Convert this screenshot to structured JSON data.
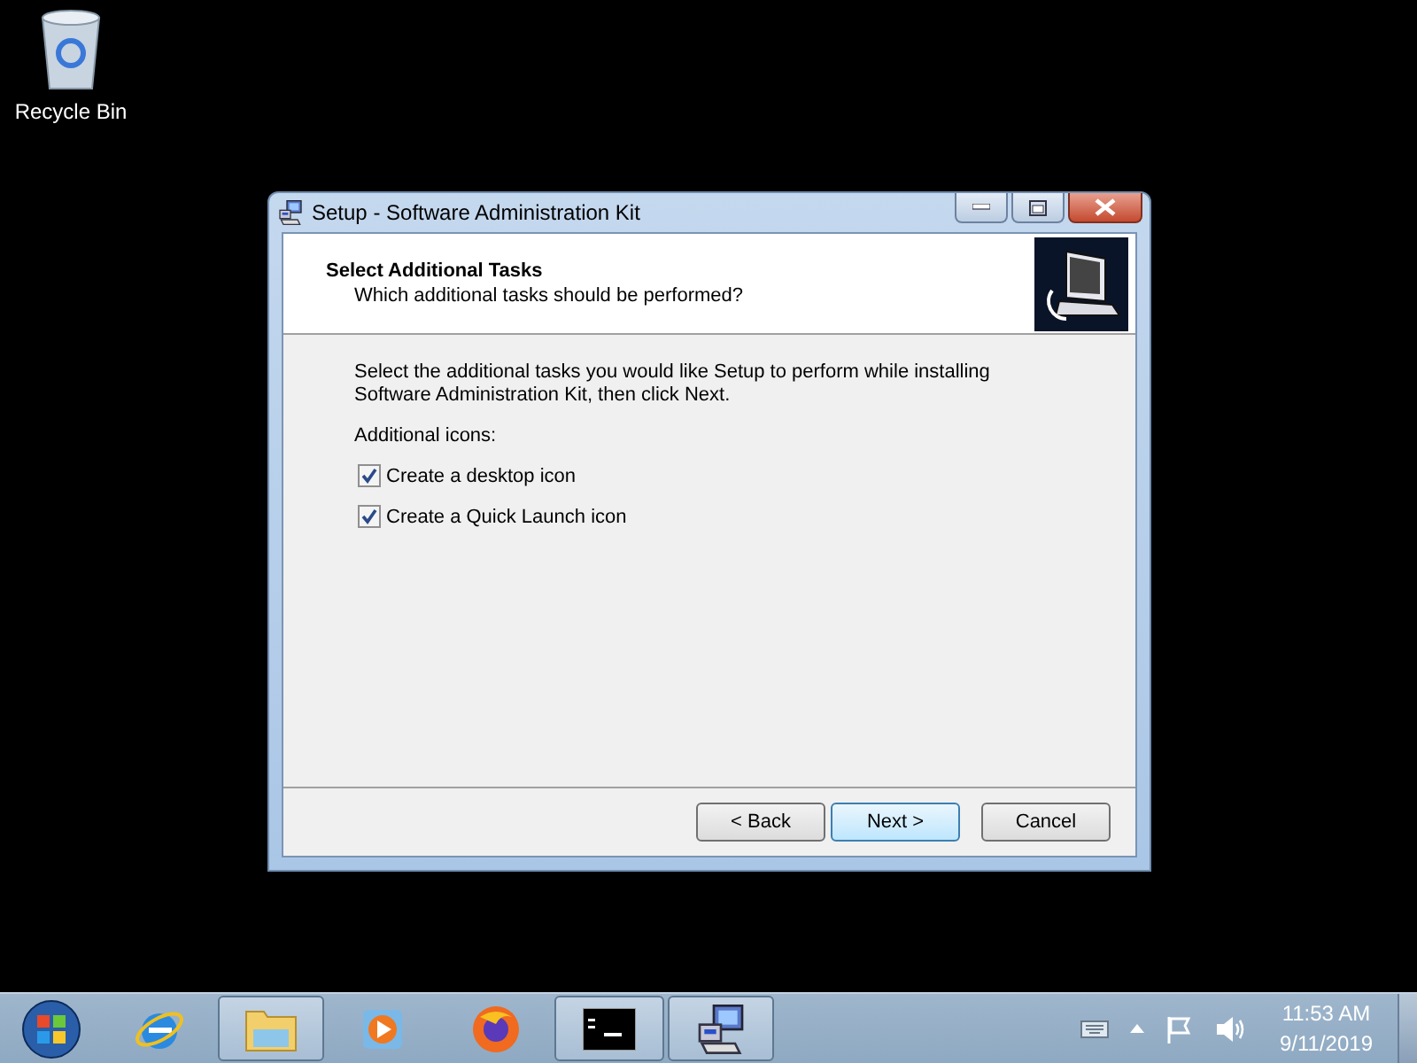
{
  "desktop": {
    "icons": [
      {
        "label": "Recycle Bin"
      }
    ]
  },
  "dialog": {
    "title": "Setup - Software Administration Kit",
    "header": {
      "title": "Select Additional Tasks",
      "subtitle": "Which additional tasks should be performed?"
    },
    "intro": "Select the additional tasks you would like Setup to perform while installing Software Administration Kit, then click Next.",
    "group_label": "Additional icons:",
    "tasks": [
      {
        "label": "Create a desktop icon",
        "checked": true
      },
      {
        "label": "Create a Quick Launch icon",
        "checked": true
      }
    ],
    "buttons": [
      {
        "label": "< Back",
        "default": false
      },
      {
        "label": "Next >",
        "default": true
      },
      {
        "label": "Cancel",
        "default": false
      }
    ]
  },
  "taskbar": {
    "items": [
      {
        "kind": "start",
        "running": false
      },
      {
        "kind": "browser-e",
        "running": false
      },
      {
        "kind": "folder",
        "running": true
      },
      {
        "kind": "media",
        "running": false
      },
      {
        "kind": "firefox",
        "running": false
      },
      {
        "kind": "console",
        "running": true
      },
      {
        "kind": "setup",
        "running": true
      }
    ],
    "tray": {
      "time": "11:53 AM",
      "date": "9/11/2019"
    }
  }
}
